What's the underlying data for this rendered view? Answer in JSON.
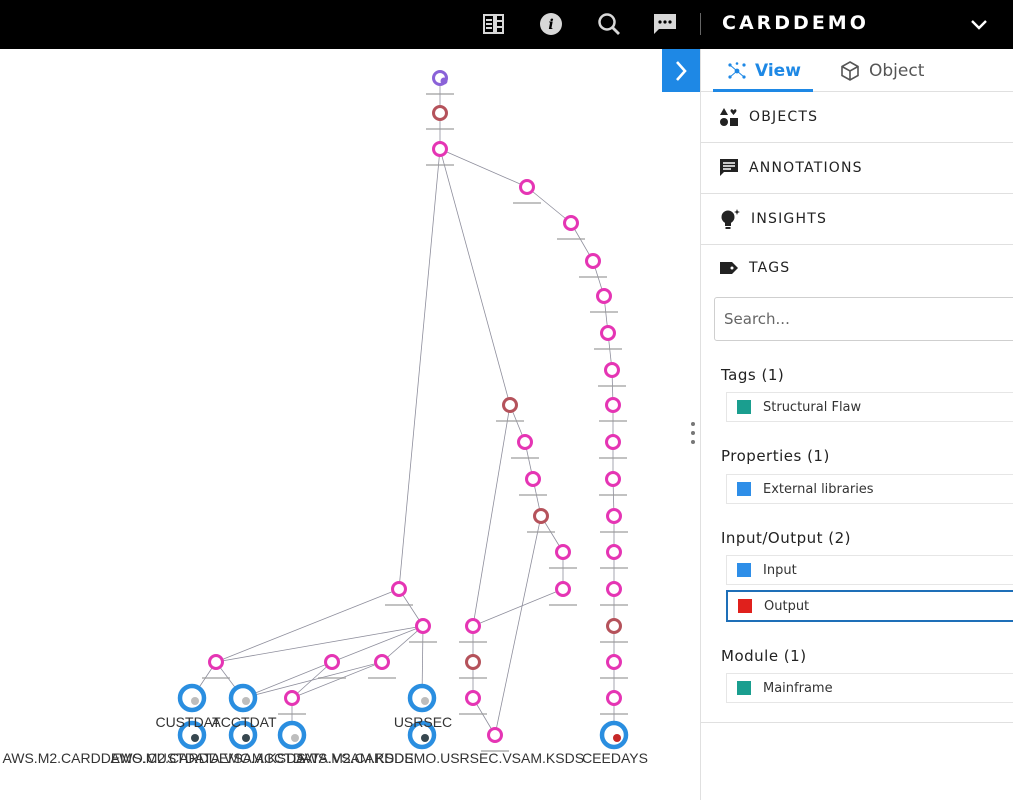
{
  "app": {
    "title": "CARDDEMO"
  },
  "topbar": {
    "icons": [
      "layers-icon",
      "info-icon",
      "search-icon",
      "chat-icon"
    ]
  },
  "panel": {
    "tabs": [
      {
        "label": "View",
        "icon": "graph-view-icon",
        "active": true
      },
      {
        "label": "Object",
        "icon": "cube-icon",
        "active": false
      }
    ],
    "sections": [
      {
        "label": "OBJECTS",
        "icon": "shapes-icon"
      },
      {
        "label": "ANNOTATIONS",
        "icon": "comment-icon"
      },
      {
        "label": "INSIGHTS",
        "icon": "lightbulb-icon"
      },
      {
        "label": "TAGS",
        "icon": "tag-icon"
      }
    ],
    "search": {
      "placeholder": "Search...",
      "value": ""
    },
    "groups": [
      {
        "title": "Tags (1)",
        "items": [
          {
            "label": "Structural Flaw",
            "color": "#1a9e8f"
          }
        ]
      },
      {
        "title": "Properties (1)",
        "items": [
          {
            "label": "External libraries",
            "color": "#2e8ee8"
          }
        ]
      },
      {
        "title": "Input/Output (2)",
        "items": [
          {
            "label": "Input",
            "color": "#2e8ee8"
          },
          {
            "label": "Output",
            "color": "#e0201c",
            "selected": true
          }
        ]
      },
      {
        "title": "Module (1)",
        "items": [
          {
            "label": "Mainframe",
            "color": "#1a9e8f"
          }
        ]
      }
    ]
  },
  "graph": {
    "colors": {
      "program": "#e535b4",
      "flawed": "#b5525b",
      "entry": "#8a62d8",
      "file": "#2a8ee0",
      "edge": "#8e8e9c"
    },
    "large_labels": [
      "CUSTDAT",
      "ACCTDAT",
      "USRSEC",
      "AWS.M2.CARDDEMO.CUSTDATA.VSAM.KSDS",
      "AWS.M2.CARDDEMO.ACCTDATA.VSAM.KSDS",
      "AWS.M2.CARDDEMO.USRSEC.VSAM.KSDS",
      "CEEDAYS"
    ]
  }
}
